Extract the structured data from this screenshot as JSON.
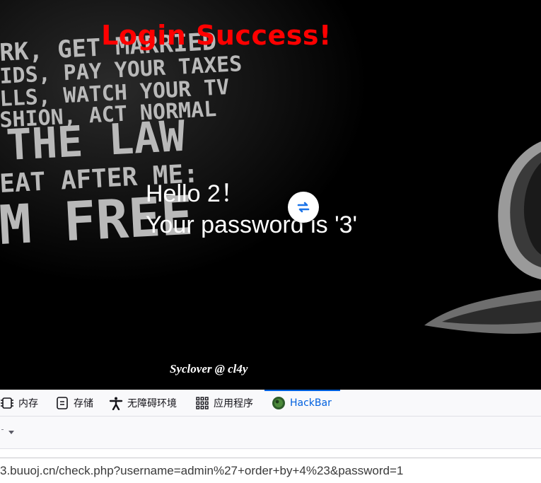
{
  "page": {
    "title": "Login Success!",
    "hello_line": "Hello 2！",
    "password_line": "Your password is '3'",
    "signature": "Syclover @ cl4y",
    "background_text": [
      "RK, GET MARRIED",
      "IDS, PAY YOUR TAXES",
      "LLS, WATCH YOUR TV",
      "SHION, ACT NORMAL",
      "THE LAW",
      "EAT AFTER ME:",
      "M FREE"
    ]
  },
  "devtools": {
    "tabs": [
      {
        "label": "内存",
        "icon": "memory-icon"
      },
      {
        "label": "存储",
        "icon": "storage-icon"
      },
      {
        "label": "无障碍环境",
        "icon": "accessibility-icon"
      },
      {
        "label": "应用程序",
        "icon": "apps-grid-icon"
      },
      {
        "label": "HackBar",
        "icon": "hackbar-icon",
        "active": true
      }
    ],
    "url": "3.buuoj.cn/check.php?username=admin%27+order+by+4%23&password=1"
  },
  "colors": {
    "title_red": "#ff0000",
    "active_tab_blue": "#0060df",
    "page_background": "#000000"
  }
}
